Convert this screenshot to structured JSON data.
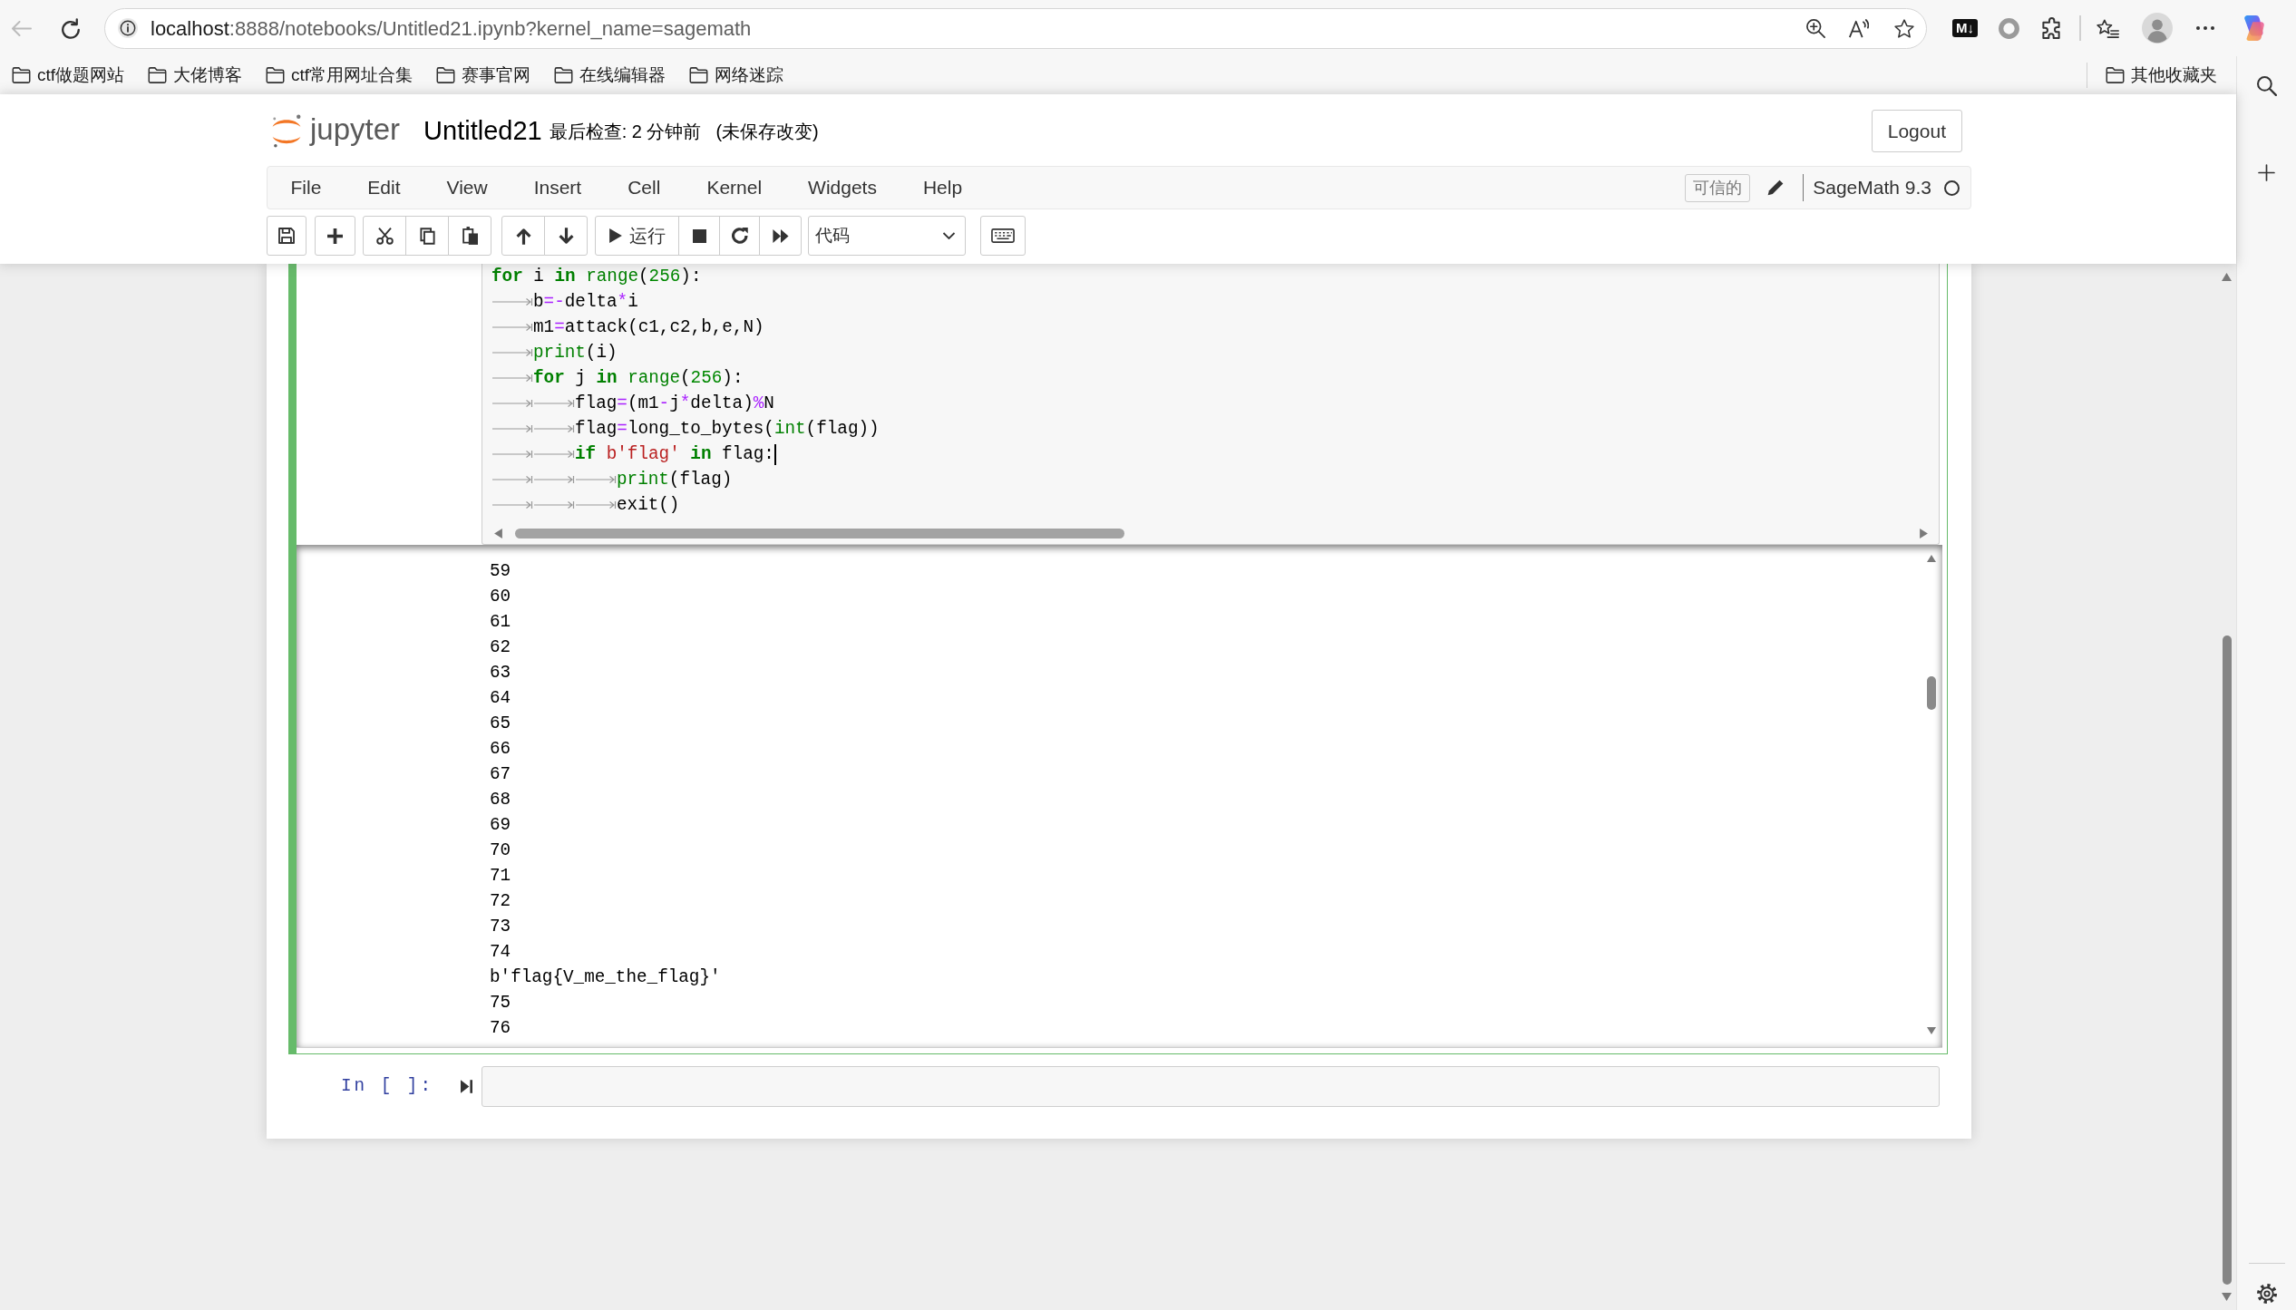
{
  "browser": {
    "back_button": {
      "disabled": true
    },
    "url": {
      "host": "localhost",
      "rest": ":8888/notebooks/Untitled21.ipynb?kernel_name=sagemath"
    },
    "extension_badge": "M↓",
    "bookmarks": [
      "ctf做题网站",
      "大佬博客",
      "ctf常用网址合集",
      "赛事官网",
      "在线编辑器",
      "网络迷踪"
    ],
    "other_bookmarks": "其他收藏夹"
  },
  "notebook": {
    "logo_text": "jupyter",
    "title": "Untitled21",
    "checkpoint": "最后检查: 2 分钟前",
    "save_status": "(未保存改变)",
    "logout": "Logout",
    "menu": [
      "File",
      "Edit",
      "View",
      "Insert",
      "Cell",
      "Kernel",
      "Widgets",
      "Help"
    ],
    "trusted": "可信的",
    "kernel": {
      "name": "SageMath 9.3",
      "busy": false
    },
    "toolbar": {
      "run_label": "运行",
      "cell_type": "代码"
    },
    "cells": [
      {
        "kind": "code",
        "selected": true,
        "lines": [
          {
            "cursor": false,
            "tokens": [
              {
                "kind": "keyword",
                "text": "for"
              },
              {
                "kind": "plain",
                "text": " i "
              },
              {
                "kind": "keyword",
                "text": "in"
              },
              {
                "kind": "builtin",
                "text": " range"
              },
              {
                "kind": "plain",
                "text": "("
              },
              {
                "kind": "number",
                "text": "256"
              },
              {
                "kind": "plain",
                "text": "):"
              }
            ]
          },
          {
            "cursor": false,
            "tokens": [
              {
                "kind": "tab"
              },
              {
                "kind": "plain",
                "text": "b"
              },
              {
                "kind": "operator",
                "text": "=-"
              },
              {
                "kind": "plain",
                "text": "delta"
              },
              {
                "kind": "operator",
                "text": "*"
              },
              {
                "kind": "plain",
                "text": "i"
              }
            ]
          },
          {
            "cursor": false,
            "tokens": [
              {
                "kind": "tab"
              },
              {
                "kind": "plain",
                "text": "m1"
              },
              {
                "kind": "operator",
                "text": "="
              },
              {
                "kind": "plain",
                "text": "attack(c1,c2,b,e,N)"
              }
            ]
          },
          {
            "cursor": false,
            "tokens": [
              {
                "kind": "tab"
              },
              {
                "kind": "builtin",
                "text": "print"
              },
              {
                "kind": "plain",
                "text": "(i)"
              }
            ]
          },
          {
            "cursor": false,
            "tokens": [
              {
                "kind": "tab"
              },
              {
                "kind": "keyword",
                "text": "for"
              },
              {
                "kind": "plain",
                "text": " j "
              },
              {
                "kind": "keyword",
                "text": "in"
              },
              {
                "kind": "builtin",
                "text": " range"
              },
              {
                "kind": "plain",
                "text": "("
              },
              {
                "kind": "number",
                "text": "256"
              },
              {
                "kind": "plain",
                "text": "):"
              }
            ]
          },
          {
            "cursor": false,
            "tokens": [
              {
                "kind": "tab"
              },
              {
                "kind": "tab"
              },
              {
                "kind": "plain",
                "text": "flag"
              },
              {
                "kind": "operator",
                "text": "="
              },
              {
                "kind": "plain",
                "text": "(m1"
              },
              {
                "kind": "operator",
                "text": "-"
              },
              {
                "kind": "plain",
                "text": "j"
              },
              {
                "kind": "operator",
                "text": "*"
              },
              {
                "kind": "plain",
                "text": "delta)"
              },
              {
                "kind": "operator",
                "text": "%"
              },
              {
                "kind": "plain",
                "text": "N"
              }
            ]
          },
          {
            "cursor": false,
            "tokens": [
              {
                "kind": "tab"
              },
              {
                "kind": "tab"
              },
              {
                "kind": "plain",
                "text": "flag"
              },
              {
                "kind": "operator",
                "text": "="
              },
              {
                "kind": "plain",
                "text": "long_to_bytes("
              },
              {
                "kind": "builtin",
                "text": "int"
              },
              {
                "kind": "plain",
                "text": "(flag))"
              }
            ]
          },
          {
            "cursor": true,
            "tokens": [
              {
                "kind": "tab"
              },
              {
                "kind": "tab"
              },
              {
                "kind": "keyword",
                "text": "if"
              },
              {
                "kind": "string",
                "text": " b'flag'"
              },
              {
                "kind": "keyword",
                "text": " in"
              },
              {
                "kind": "plain",
                "text": " flag:"
              }
            ]
          },
          {
            "cursor": false,
            "tokens": [
              {
                "kind": "tab"
              },
              {
                "kind": "tab"
              },
              {
                "kind": "tab"
              },
              {
                "kind": "builtin",
                "text": "print"
              },
              {
                "kind": "plain",
                "text": "(flag)"
              }
            ]
          },
          {
            "cursor": false,
            "tokens": [
              {
                "kind": "tab"
              },
              {
                "kind": "tab"
              },
              {
                "kind": "tab"
              },
              {
                "kind": "plain",
                "text": "exit()"
              }
            ]
          }
        ],
        "output": [
          "59",
          "60",
          "61",
          "62",
          "63",
          "64",
          "65",
          "66",
          "67",
          "68",
          "69",
          "70",
          "71",
          "72",
          "73",
          "74",
          "b'flag{V_me_the_flag}'",
          "75",
          "76"
        ]
      },
      {
        "kind": "code",
        "selected": false,
        "prompt": "In [ ]:"
      }
    ]
  }
}
